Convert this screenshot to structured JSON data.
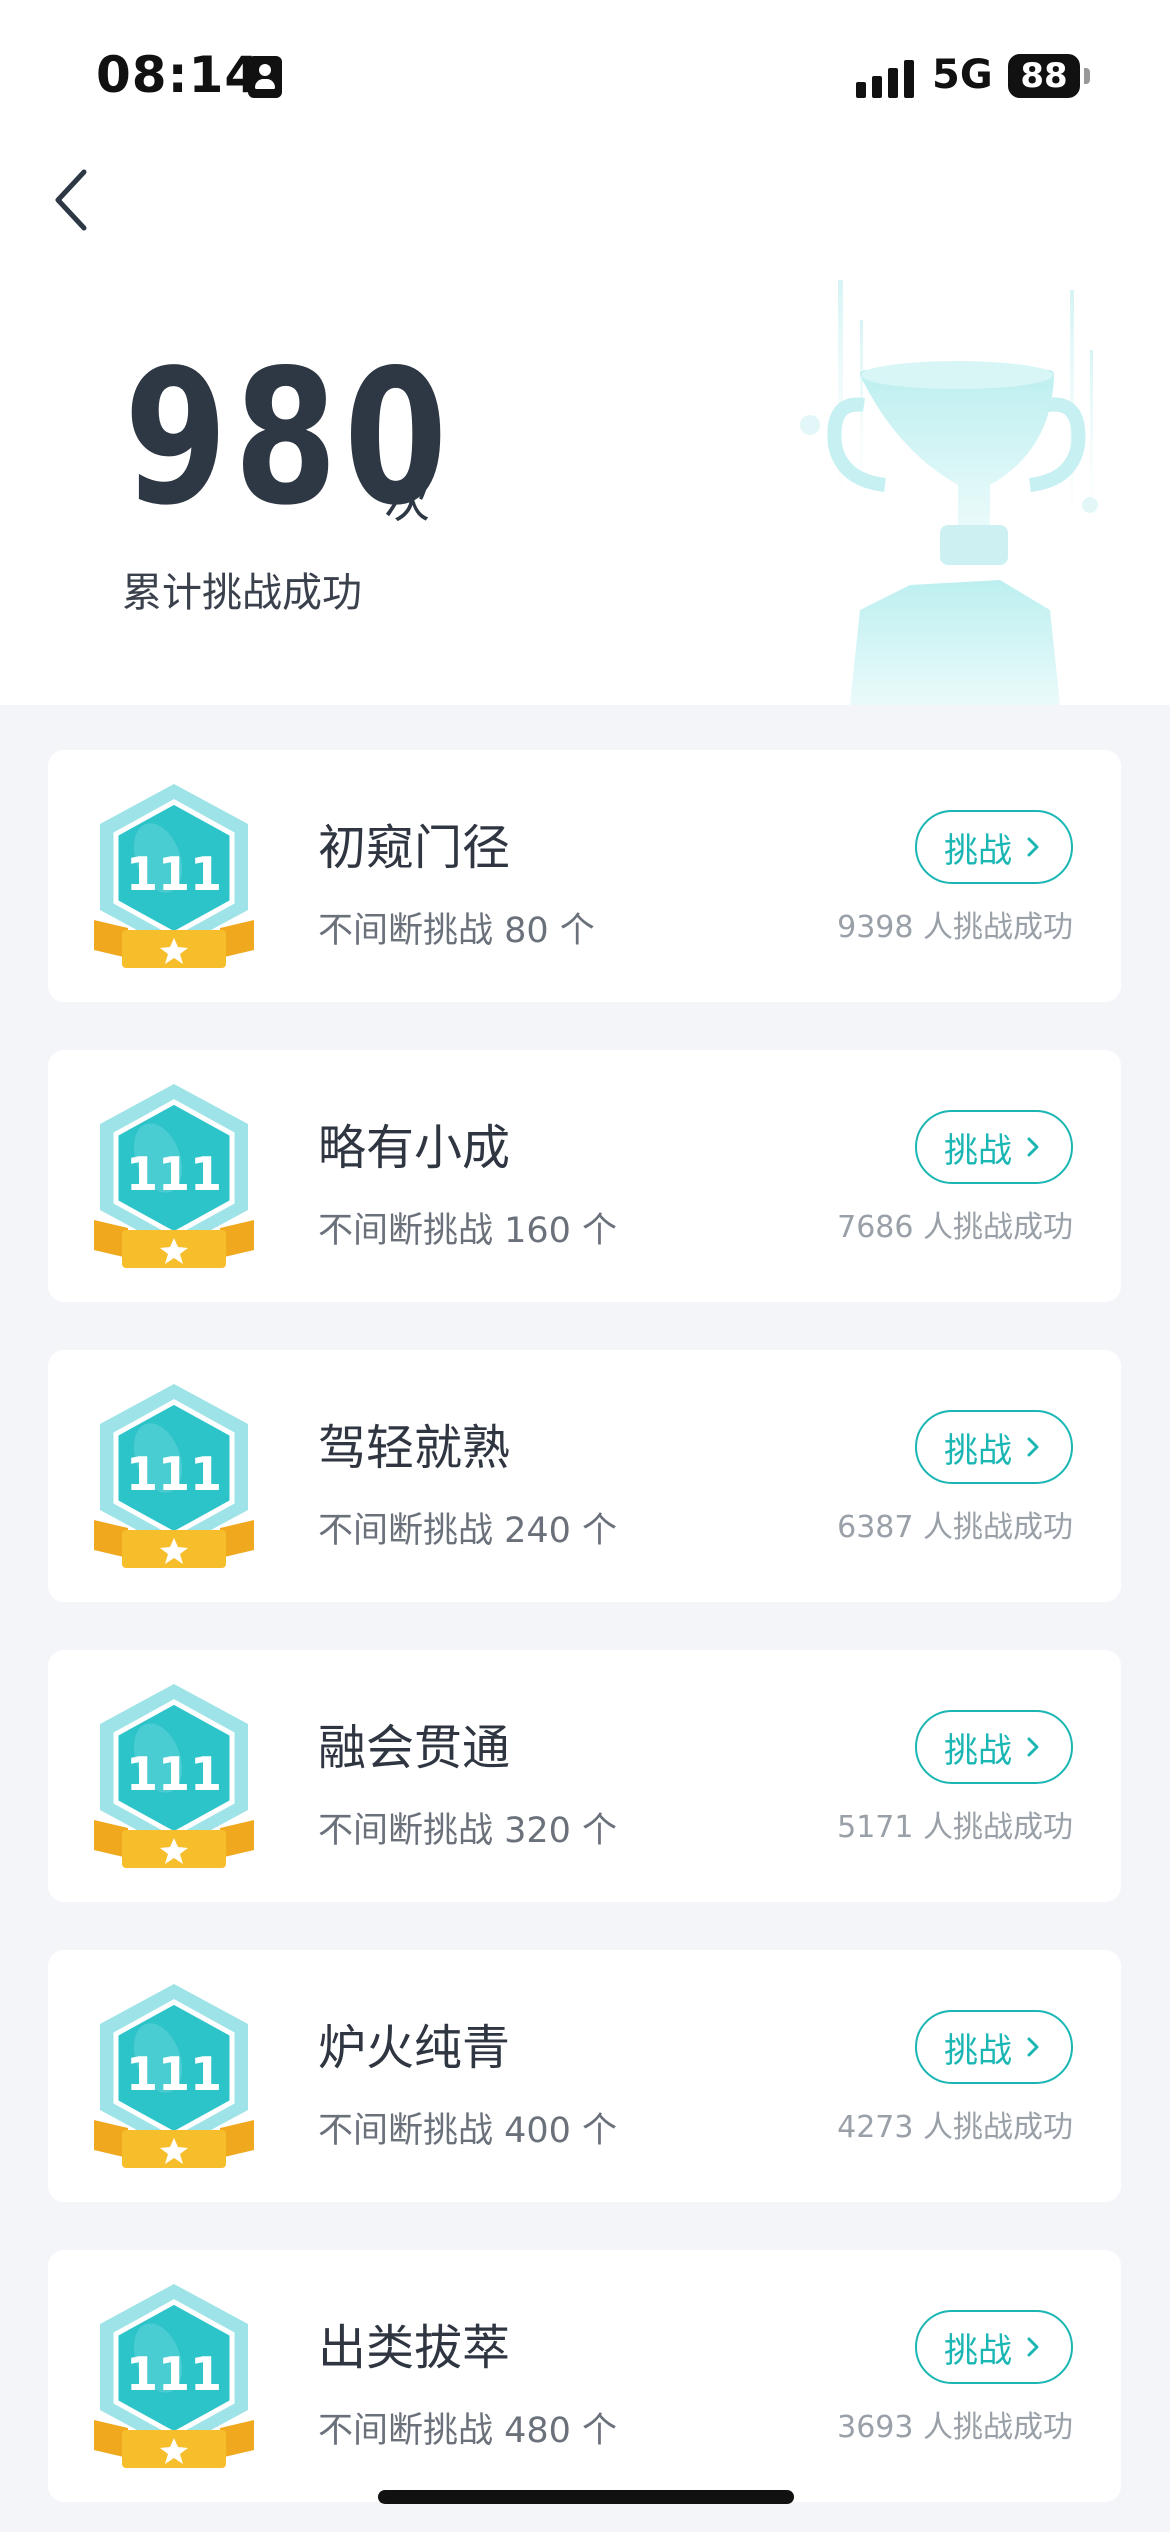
{
  "status_bar": {
    "time": "08:14",
    "network": "5G",
    "battery": "88"
  },
  "header": {
    "back_icon": "chevron-left-icon"
  },
  "summary": {
    "count": "980",
    "unit": "次",
    "caption": "累计挑战成功"
  },
  "challenges": [
    {
      "title": "初窥门径",
      "desc": "不间断挑战 80 个",
      "button": "挑战",
      "success": "9398 人挑战成功"
    },
    {
      "title": "略有小成",
      "desc": "不间断挑战 160 个",
      "button": "挑战",
      "success": "7686 人挑战成功"
    },
    {
      "title": "驾轻就熟",
      "desc": "不间断挑战 240 个",
      "button": "挑战",
      "success": "6387 人挑战成功"
    },
    {
      "title": "融会贯通",
      "desc": "不间断挑战 320 个",
      "button": "挑战",
      "success": "5171 人挑战成功"
    },
    {
      "title": "炉火纯青",
      "desc": "不间断挑战 400 个",
      "button": "挑战",
      "success": "4273 人挑战成功"
    },
    {
      "title": "出类拔萃",
      "desc": "不间断挑战 480 个",
      "button": "挑战",
      "success": "3693 人挑战成功"
    }
  ],
  "colors": {
    "accent": "#19b6b3",
    "badge_teal": "#2cc3c9",
    "badge_ribbon": "#f7be2c",
    "background": "#f4f5f9"
  }
}
